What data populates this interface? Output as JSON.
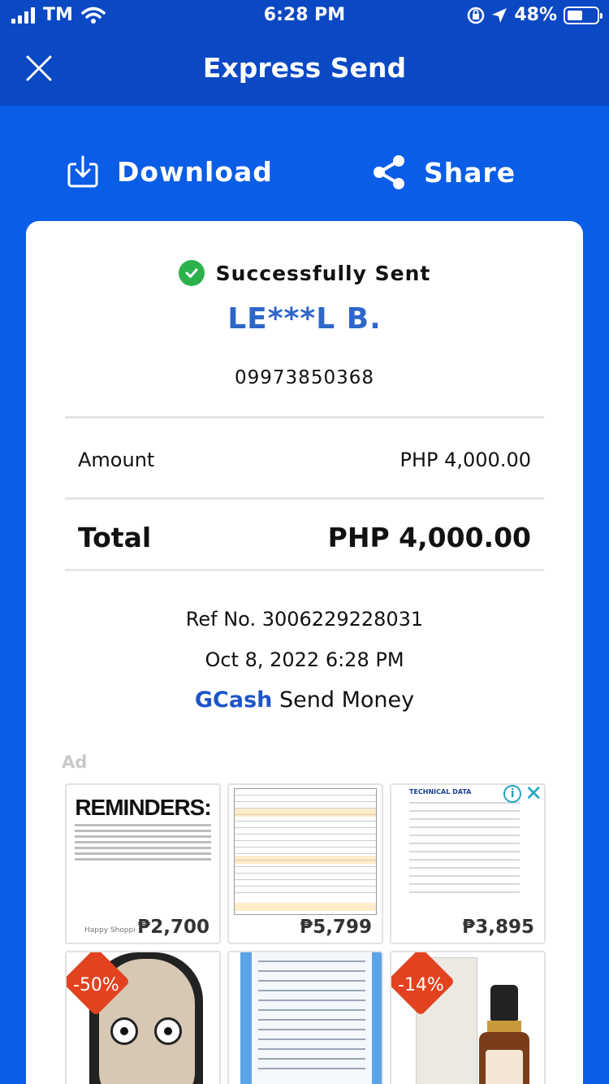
{
  "status_bar": {
    "carrier": "TM",
    "time": "6:28 PM",
    "battery": "48%"
  },
  "header": {
    "title": "Express Send"
  },
  "actions": {
    "download": "Download",
    "share": "Share"
  },
  "receipt": {
    "status": "Successfully Sent",
    "recipient": "LE***L B.",
    "phone": "09973850368",
    "amount_label": "Amount",
    "amount_value": "PHP 4,000.00",
    "total_label": "Total",
    "total_value": "PHP 4,000.00",
    "ref": "Ref No. 3006229228031",
    "date": "Oct 8, 2022 6:28 PM",
    "brand": "GCash",
    "service": "Send Money"
  },
  "ad": {
    "label": "Ad",
    "info_icon": "i",
    "close_icon": "✕",
    "tiles": [
      {
        "title": "REMINDERS:",
        "footer": "Happy Shopping!",
        "price": "₱2,700"
      },
      {
        "price": "₱5,799"
      },
      {
        "title": "TECHNICAL DATA",
        "price": "₱3,895"
      },
      {
        "badge": "-50%"
      },
      {},
      {
        "badge": "-14%"
      }
    ]
  },
  "colors": {
    "background": "#0a5de6",
    "appbar": "#0a48c4",
    "success": "#2bb24c",
    "recipient": "#2e66c9",
    "gcash": "#1e55c8",
    "badge": "#e2421f"
  }
}
